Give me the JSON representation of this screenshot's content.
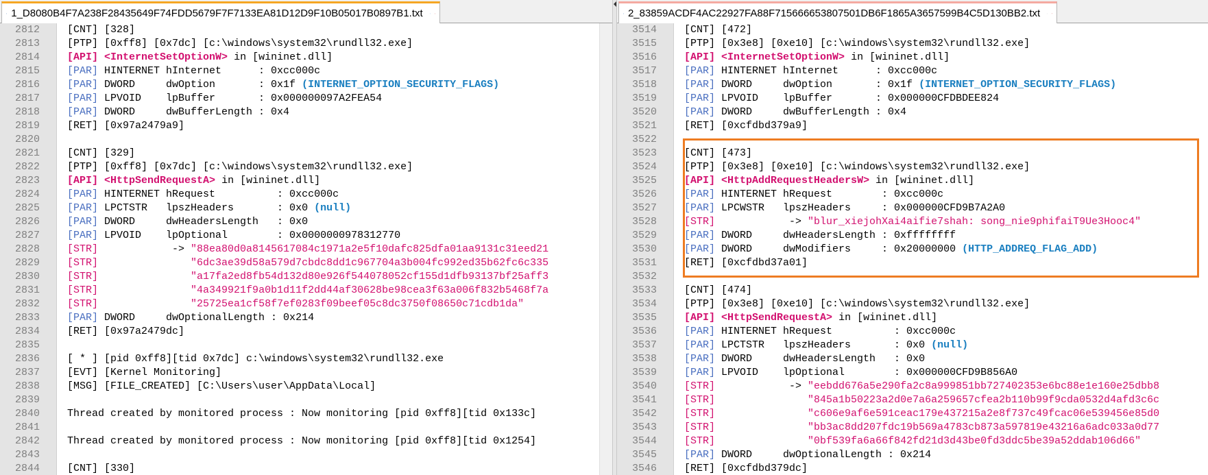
{
  "colors": {
    "accent_tab_left": "#f5a623",
    "api": "#d2106f",
    "par": "#4a6fc0",
    "note": "#1a7fc0",
    "highlight": "#ee7c22"
  },
  "left": {
    "tab_title": "1_D8080B4F7A238F28435649F74FDD5679F7F7133EA81D12D9F10B05017B0897B1.txt",
    "lines": [
      {
        "n": "2812",
        "segs": [
          {
            "t": "[CNT] [328]"
          }
        ]
      },
      {
        "n": "2813",
        "segs": [
          {
            "t": "[PTP] [0xff8] [0x7dc] [c:\\windows\\system32\\rundll32.exe]"
          }
        ]
      },
      {
        "n": "2814",
        "segs": [
          {
            "t": "[API]",
            "c": "tag-api"
          },
          {
            "t": " "
          },
          {
            "t": "<InternetSetOptionW>",
            "c": "fn"
          },
          {
            "t": " in [wininet.dll]"
          }
        ]
      },
      {
        "n": "2815",
        "segs": [
          {
            "t": "[PAR]",
            "c": "tag-par"
          },
          {
            "t": " HINTERNET hInternet      : 0xcc000c"
          }
        ]
      },
      {
        "n": "2816",
        "segs": [
          {
            "t": "[PAR]",
            "c": "tag-par"
          },
          {
            "t": " DWORD     dwOption       : 0x1f "
          },
          {
            "t": "(INTERNET_OPTION_SECURITY_FLAGS)",
            "c": "note"
          }
        ]
      },
      {
        "n": "2817",
        "segs": [
          {
            "t": "[PAR]",
            "c": "tag-par"
          },
          {
            "t": " LPVOID    lpBuffer       : 0x000000097A2FEA54"
          }
        ]
      },
      {
        "n": "2818",
        "segs": [
          {
            "t": "[PAR]",
            "c": "tag-par"
          },
          {
            "t": " DWORD     dwBufferLength : 0x4"
          }
        ]
      },
      {
        "n": "2819",
        "segs": [
          {
            "t": "[RET] [0x97a2479a9]"
          }
        ]
      },
      {
        "n": "2820",
        "segs": []
      },
      {
        "n": "2821",
        "segs": [
          {
            "t": "[CNT] [329]"
          }
        ]
      },
      {
        "n": "2822",
        "segs": [
          {
            "t": "[PTP] [0xff8] [0x7dc] [c:\\windows\\system32\\rundll32.exe]"
          }
        ]
      },
      {
        "n": "2823",
        "segs": [
          {
            "t": "[API]",
            "c": "tag-api"
          },
          {
            "t": " "
          },
          {
            "t": "<HttpSendRequestA>",
            "c": "fn"
          },
          {
            "t": " in [wininet.dll]"
          }
        ]
      },
      {
        "n": "2824",
        "segs": [
          {
            "t": "[PAR]",
            "c": "tag-par"
          },
          {
            "t": " HINTERNET hRequest          : 0xcc000c"
          }
        ]
      },
      {
        "n": "2825",
        "segs": [
          {
            "t": "[PAR]",
            "c": "tag-par"
          },
          {
            "t": " LPCTSTR   lpszHeaders       : 0x0 "
          },
          {
            "t": "(null)",
            "c": "note"
          }
        ]
      },
      {
        "n": "2826",
        "segs": [
          {
            "t": "[PAR]",
            "c": "tag-par"
          },
          {
            "t": " DWORD     dwHeadersLength   : 0x0"
          }
        ]
      },
      {
        "n": "2827",
        "segs": [
          {
            "t": "[PAR]",
            "c": "tag-par"
          },
          {
            "t": " LPVOID    lpOptional        : 0x0000000978312770"
          }
        ]
      },
      {
        "n": "2828",
        "segs": [
          {
            "t": "[STR]",
            "c": "tag-str"
          },
          {
            "t": "            -> "
          },
          {
            "t": "\"88ea80d0a8145617084c1971a2e5f10dafc825dfa01aa9131c31eed21",
            "c": "str"
          }
        ]
      },
      {
        "n": "2829",
        "segs": [
          {
            "t": "[STR]",
            "c": "tag-str"
          },
          {
            "t": "               "
          },
          {
            "t": "\"6dc3ae39d58a579d7cbdc8dd1c967704a3b004fc992ed35b62fc6c335",
            "c": "str"
          }
        ]
      },
      {
        "n": "2830",
        "segs": [
          {
            "t": "[STR]",
            "c": "tag-str"
          },
          {
            "t": "               "
          },
          {
            "t": "\"a17fa2ed8fb54d132d80e926f544078052cf155d1dfb93137bf25aff3",
            "c": "str"
          }
        ]
      },
      {
        "n": "2831",
        "segs": [
          {
            "t": "[STR]",
            "c": "tag-str"
          },
          {
            "t": "               "
          },
          {
            "t": "\"4a349921f9a0b1d11f2dd44af30628be98cea3f63a006f832b5468f7a",
            "c": "str"
          }
        ]
      },
      {
        "n": "2832",
        "segs": [
          {
            "t": "[STR]",
            "c": "tag-str"
          },
          {
            "t": "               "
          },
          {
            "t": "\"25725ea1cf58f7ef0283f09beef05c8dc3750f08650c71cdb1da\"",
            "c": "str"
          }
        ]
      },
      {
        "n": "2833",
        "segs": [
          {
            "t": "[PAR]",
            "c": "tag-par"
          },
          {
            "t": " DWORD     dwOptionalLength : 0x214"
          }
        ]
      },
      {
        "n": "2834",
        "segs": [
          {
            "t": "[RET] [0x97a2479dc]"
          }
        ]
      },
      {
        "n": "2835",
        "segs": []
      },
      {
        "n": "2836",
        "segs": [
          {
            "t": "[ * ] [pid 0xff8][tid 0x7dc] c:\\windows\\system32\\rundll32.exe"
          }
        ]
      },
      {
        "n": "2837",
        "segs": [
          {
            "t": "[EVT] [Kernel Monitoring]"
          }
        ]
      },
      {
        "n": "2838",
        "segs": [
          {
            "t": "[MSG] [FILE_CREATED] [C:\\Users\\user\\AppData\\Local]"
          }
        ]
      },
      {
        "n": "2839",
        "segs": []
      },
      {
        "n": "2840",
        "segs": [
          {
            "t": "Thread created by monitored process : Now monitoring [pid 0xff8][tid 0x133c]"
          }
        ]
      },
      {
        "n": "2841",
        "segs": []
      },
      {
        "n": "2842",
        "segs": [
          {
            "t": "Thread created by monitored process : Now monitoring [pid 0xff8][tid 0x1254]"
          }
        ]
      },
      {
        "n": "2843",
        "segs": []
      },
      {
        "n": "2844",
        "segs": [
          {
            "t": "[CNT] [330]"
          }
        ]
      }
    ]
  },
  "right": {
    "tab_title": "2_83859ACDF4AC22927FA88F715666653807501DB6F1865A3657599B4C5D130BB2.txt",
    "lines": [
      {
        "n": "3514",
        "segs": [
          {
            "t": "[CNT] [472]"
          }
        ]
      },
      {
        "n": "3515",
        "segs": [
          {
            "t": "[PTP] [0x3e8] [0xe10] [c:\\windows\\system32\\rundll32.exe]"
          }
        ]
      },
      {
        "n": "3516",
        "segs": [
          {
            "t": "[API]",
            "c": "tag-api"
          },
          {
            "t": " "
          },
          {
            "t": "<InternetSetOptionW>",
            "c": "fn"
          },
          {
            "t": " in [wininet.dll]"
          }
        ]
      },
      {
        "n": "3517",
        "segs": [
          {
            "t": "[PAR]",
            "c": "tag-par"
          },
          {
            "t": " HINTERNET hInternet      : 0xcc000c"
          }
        ]
      },
      {
        "n": "3518",
        "segs": [
          {
            "t": "[PAR]",
            "c": "tag-par"
          },
          {
            "t": " DWORD     dwOption       : 0x1f "
          },
          {
            "t": "(INTERNET_OPTION_SECURITY_FLAGS)",
            "c": "note"
          }
        ]
      },
      {
        "n": "3519",
        "segs": [
          {
            "t": "[PAR]",
            "c": "tag-par"
          },
          {
            "t": " LPVOID    lpBuffer       : 0x000000CFDBDEE824"
          }
        ]
      },
      {
        "n": "3520",
        "segs": [
          {
            "t": "[PAR]",
            "c": "tag-par"
          },
          {
            "t": " DWORD     dwBufferLength : 0x4"
          }
        ]
      },
      {
        "n": "3521",
        "segs": [
          {
            "t": "[RET] [0xcfdbd379a9]"
          }
        ]
      },
      {
        "n": "3522",
        "segs": []
      },
      {
        "n": "3523",
        "segs": [
          {
            "t": "[CNT] [473]"
          }
        ]
      },
      {
        "n": "3524",
        "segs": [
          {
            "t": "[PTP] [0x3e8] [0xe10] [c:\\windows\\system32\\rundll32.exe]"
          }
        ]
      },
      {
        "n": "3525",
        "segs": [
          {
            "t": "[API]",
            "c": "tag-api"
          },
          {
            "t": " "
          },
          {
            "t": "<HttpAddRequestHeadersW>",
            "c": "fn"
          },
          {
            "t": " in [wininet.dll]"
          }
        ]
      },
      {
        "n": "3526",
        "segs": [
          {
            "t": "[PAR]",
            "c": "tag-par"
          },
          {
            "t": " HINTERNET hRequest        : 0xcc000c"
          }
        ]
      },
      {
        "n": "3527",
        "segs": [
          {
            "t": "[PAR]",
            "c": "tag-par"
          },
          {
            "t": " LPCWSTR   lpszHeaders     : 0x000000CFD9B7A2A0"
          }
        ]
      },
      {
        "n": "3528",
        "segs": [
          {
            "t": "[STR]",
            "c": "tag-str"
          },
          {
            "t": "            -> "
          },
          {
            "t": "\"blur_xiejohXai4aifie7shah: song_nie9phifaiT9Ue3Hooc4\"",
            "c": "str"
          }
        ]
      },
      {
        "n": "3529",
        "segs": [
          {
            "t": "[PAR]",
            "c": "tag-par"
          },
          {
            "t": " DWORD     dwHeadersLength : 0xffffffff"
          }
        ]
      },
      {
        "n": "3530",
        "segs": [
          {
            "t": "[PAR]",
            "c": "tag-par"
          },
          {
            "t": " DWORD     dwModifiers     : 0x20000000 "
          },
          {
            "t": "(HTTP_ADDREQ_FLAG_ADD)",
            "c": "note"
          }
        ]
      },
      {
        "n": "3531",
        "segs": [
          {
            "t": "[RET] [0xcfdbd37a01]"
          }
        ]
      },
      {
        "n": "3532",
        "segs": []
      },
      {
        "n": "3533",
        "segs": [
          {
            "t": "[CNT] [474]"
          }
        ]
      },
      {
        "n": "3534",
        "segs": [
          {
            "t": "[PTP] [0x3e8] [0xe10] [c:\\windows\\system32\\rundll32.exe]"
          }
        ]
      },
      {
        "n": "3535",
        "segs": [
          {
            "t": "[API]",
            "c": "tag-api"
          },
          {
            "t": " "
          },
          {
            "t": "<HttpSendRequestA>",
            "c": "fn"
          },
          {
            "t": " in [wininet.dll]"
          }
        ]
      },
      {
        "n": "3536",
        "segs": [
          {
            "t": "[PAR]",
            "c": "tag-par"
          },
          {
            "t": " HINTERNET hRequest          : 0xcc000c"
          }
        ]
      },
      {
        "n": "3537",
        "segs": [
          {
            "t": "[PAR]",
            "c": "tag-par"
          },
          {
            "t": " LPCTSTR   lpszHeaders       : 0x0 "
          },
          {
            "t": "(null)",
            "c": "note"
          }
        ]
      },
      {
        "n": "3538",
        "segs": [
          {
            "t": "[PAR]",
            "c": "tag-par"
          },
          {
            "t": " DWORD     dwHeadersLength   : 0x0"
          }
        ]
      },
      {
        "n": "3539",
        "segs": [
          {
            "t": "[PAR]",
            "c": "tag-par"
          },
          {
            "t": " LPVOID    lpOptional        : 0x000000CFD9B856A0"
          }
        ]
      },
      {
        "n": "3540",
        "segs": [
          {
            "t": "[STR]",
            "c": "tag-str"
          },
          {
            "t": "            -> "
          },
          {
            "t": "\"eebdd676a5e290fa2c8a999851bb727402353e6bc88e1e160e25dbb8",
            "c": "str"
          }
        ]
      },
      {
        "n": "3541",
        "segs": [
          {
            "t": "[STR]",
            "c": "tag-str"
          },
          {
            "t": "               "
          },
          {
            "t": "\"845a1b50223a2d0e7a6a259657cfea2b110b99f9cda0532d4afd3c6c",
            "c": "str"
          }
        ]
      },
      {
        "n": "3542",
        "segs": [
          {
            "t": "[STR]",
            "c": "tag-str"
          },
          {
            "t": "               "
          },
          {
            "t": "\"c606e9af6e591ceac179e437215a2e8f737c49fcac06e539456e85d0",
            "c": "str"
          }
        ]
      },
      {
        "n": "3543",
        "segs": [
          {
            "t": "[STR]",
            "c": "tag-str"
          },
          {
            "t": "               "
          },
          {
            "t": "\"bb3ac8dd207fdc19b569a4783cb873a597819e43216a6adc033a0d77",
            "c": "str"
          }
        ]
      },
      {
        "n": "3544",
        "segs": [
          {
            "t": "[STR]",
            "c": "tag-str"
          },
          {
            "t": "               "
          },
          {
            "t": "\"0bf539fa6a66f842fd21d3d43be0fd3ddc5be39a52ddab106d66\"",
            "c": "str"
          }
        ]
      },
      {
        "n": "3545",
        "segs": [
          {
            "t": "[PAR]",
            "c": "tag-par"
          },
          {
            "t": " DWORD     dwOptionalLength : 0x214"
          }
        ]
      },
      {
        "n": "3546",
        "segs": [
          {
            "t": "[RET] [0xcfdbd379dc]"
          }
        ]
      }
    ]
  }
}
